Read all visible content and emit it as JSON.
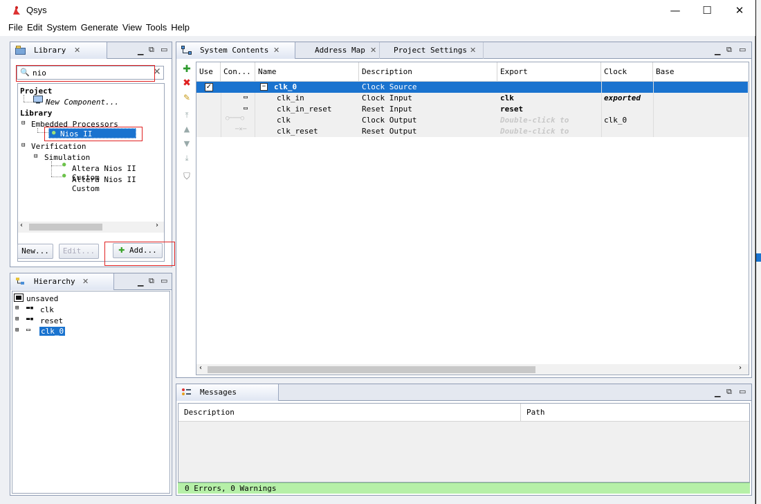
{
  "window": {
    "title": "Qsys",
    "minimize": "—",
    "maximize": "☐",
    "close": "✕"
  },
  "menu": [
    "File",
    "Edit",
    "System",
    "Generate",
    "View",
    "Tools",
    "Help"
  ],
  "library": {
    "tab_label": "Library",
    "search_value": "nio",
    "project_heading": "Project",
    "new_component": "New Component...",
    "library_heading": "Library",
    "embedded_processors": "Embedded Processors",
    "nios_processor": "Nios II Processor",
    "verification": "Verification",
    "simulation": "Simulation",
    "custom1": "Altera Nios II Custom",
    "custom2": "Altera Nios II Custom",
    "new_button": "New...",
    "edit_button": "Edit...",
    "add_button": "Add..."
  },
  "hierarchy": {
    "tab_label": "Hierarchy",
    "root": "unsaved",
    "items": [
      "clk",
      "reset",
      "clk_0"
    ]
  },
  "system": {
    "tabs": [
      "System Contents",
      "Address Map",
      "Project Settings"
    ],
    "columns": [
      "Use",
      "Con...",
      "Name",
      "Description",
      "Export",
      "Clock",
      "Base"
    ],
    "rows": [
      {
        "name": "clk_0",
        "description": "Clock Source",
        "export": "",
        "clock": "",
        "selected": true,
        "checked": true
      },
      {
        "name": "clk_in",
        "description": "Clock Input",
        "export": "clk",
        "clock": "exported"
      },
      {
        "name": "clk_in_reset",
        "description": "Reset Input",
        "export": "reset",
        "clock": ""
      },
      {
        "name": "clk",
        "description": "Clock Output",
        "export": "Double-click to",
        "clock": "clk_0"
      },
      {
        "name": "clk_reset",
        "description": "Reset Output",
        "export": "Double-click to",
        "clock": ""
      }
    ]
  },
  "messages": {
    "tab_label": "Messages",
    "columns": [
      "Description",
      "Path"
    ],
    "status": "0 Errors, 0 Warnings"
  },
  "colors": {
    "selection": "#1a73cf",
    "status_green": "#b6f0a8",
    "accent_red": "#e02020"
  }
}
